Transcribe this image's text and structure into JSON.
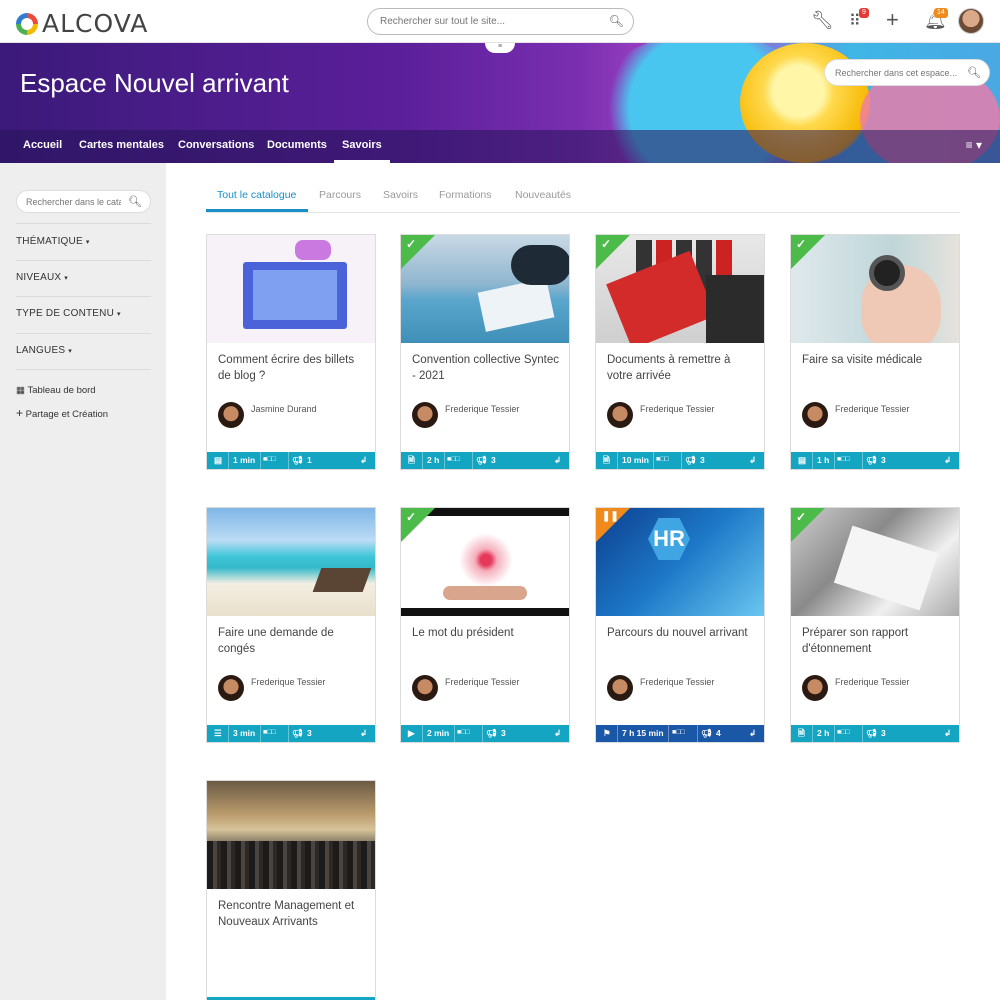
{
  "topbar": {
    "logo_text": "ALCOVA",
    "search_placeholder": "Rechercher sur tout le site...",
    "apps_badge": "9",
    "notif_badge": "14"
  },
  "banner": {
    "title": "Espace Nouvel arrivant",
    "search_placeholder": "Rechercher dans cet espace..."
  },
  "nav": {
    "items": [
      "Accueil",
      "Cartes mentales",
      "Conversations",
      "Documents",
      "Savoirs"
    ],
    "active": "Savoirs"
  },
  "sidebar": {
    "search_placeholder": "Rechercher dans le catalogue",
    "filters": [
      "THÉMATIQUE",
      "NIVEAUX",
      "TYPE DE CONTENU",
      "LANGUES"
    ],
    "links": [
      "Tableau de bord",
      "Partage et Création"
    ]
  },
  "tabs": {
    "items": [
      "Tout le catalogue",
      "Parcours",
      "Savoirs",
      "Formations",
      "Nouveautés"
    ],
    "active": "Tout le catalogue"
  },
  "cards": [
    {
      "title": "Comment écrire des billets de blog ?",
      "author": "Jasmine Durand",
      "duration": "1 min",
      "level": "■□□",
      "count": "1",
      "completed": false,
      "type_icon": "document-icon"
    },
    {
      "title": "Convention collective Syntec - 2021",
      "author": "Frederique Tessier",
      "duration": "2 h",
      "level": "■□□",
      "count": "3",
      "completed": true,
      "type_icon": "file-icon"
    },
    {
      "title": "Documents à remettre à votre arrivée",
      "author": "Frederique Tessier",
      "duration": "10 min",
      "level": "■□□",
      "count": "3",
      "completed": true,
      "type_icon": "file-icon"
    },
    {
      "title": "Faire sa visite médicale",
      "author": "Frederique Tessier",
      "duration": "1 h",
      "level": "■□□",
      "count": "3",
      "completed": true,
      "type_icon": "document-icon"
    },
    {
      "title": "Faire une demande de congés",
      "author": "Frederique Tessier",
      "duration": "3 min",
      "level": "■□□",
      "count": "3",
      "completed": false,
      "type_icon": "list-icon"
    },
    {
      "title": "Le mot du président",
      "author": "Frederique Tessier",
      "duration": "2 min",
      "level": "■□□",
      "count": "3",
      "completed": true,
      "type_icon": "video-icon"
    },
    {
      "title": "Parcours du nouvel arrivant",
      "author": "Frederique Tessier",
      "duration": "7 h 15 min",
      "level": "■□□",
      "count": "4",
      "completed": false,
      "paused": true,
      "type_icon": "flag-icon"
    },
    {
      "title": "Préparer son rapport d'étonnement",
      "author": "Frederique Tessier",
      "duration": "2 h",
      "level": "■□□",
      "count": "3",
      "completed": true,
      "type_icon": "file-icon"
    },
    {
      "title": "Rencontre Management et Nouveaux Arrivants",
      "author": "",
      "duration": "",
      "level": "",
      "count": "",
      "completed": false,
      "type_icon": ""
    }
  ],
  "colors": {
    "accent": "#1a8fc7",
    "card_footer": "#14a5c2",
    "card_footer_path": "#1b57a7",
    "check_green": "#4cbb4a",
    "pause_orange": "#f08a1d",
    "sidebar_bg": "#eeeeee"
  }
}
